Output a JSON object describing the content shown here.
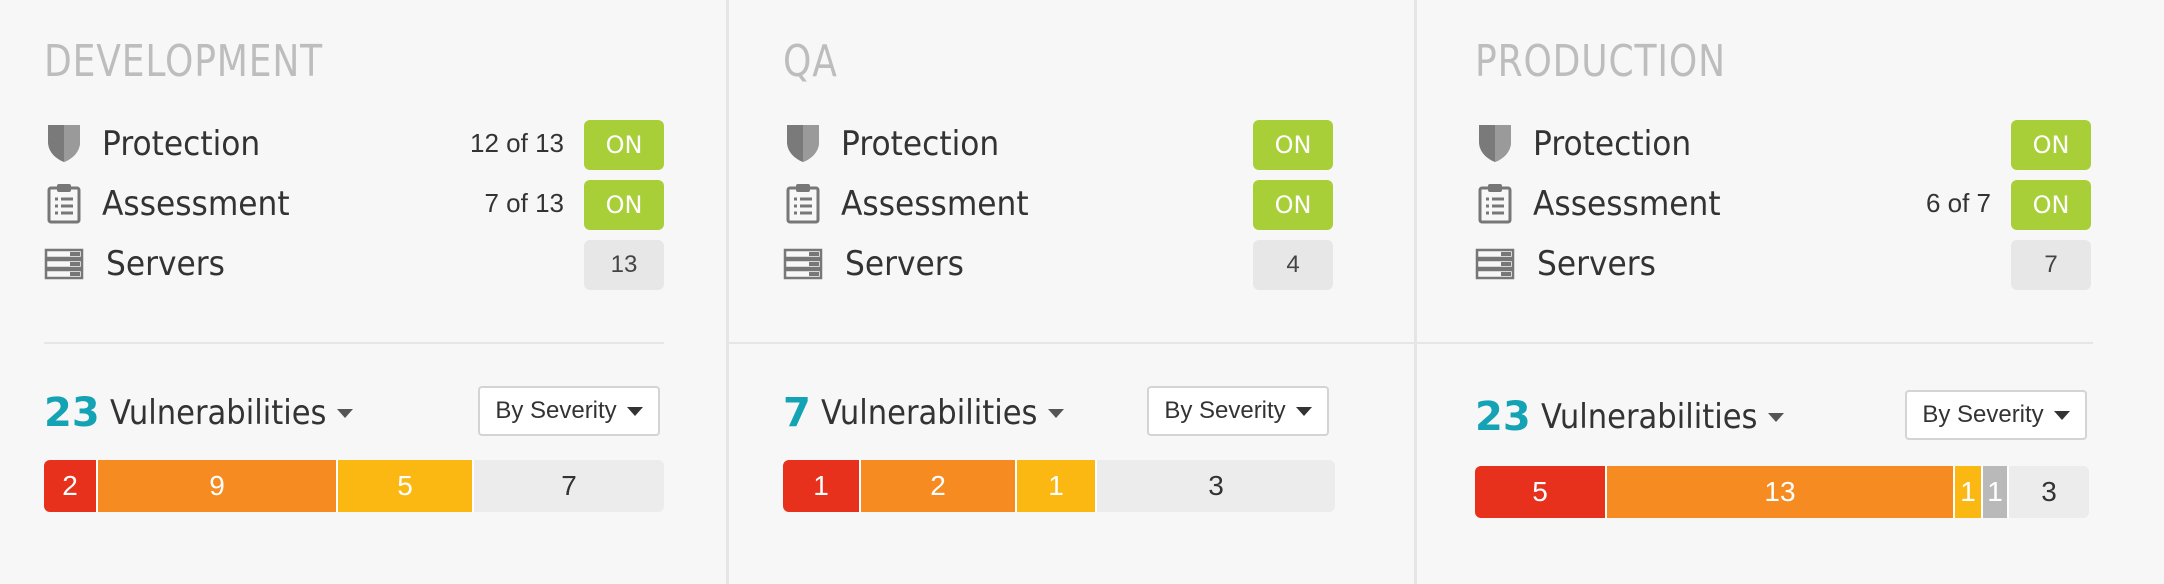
{
  "environments": [
    {
      "title": "DEVELOPMENT",
      "protection": {
        "label": "Protection",
        "count": "12 of 13",
        "status": "ON"
      },
      "assessment": {
        "label": "Assessment",
        "count": "7 of 13",
        "status": "ON"
      },
      "servers": {
        "label": "Servers",
        "count": "13"
      },
      "vulnerabilities": {
        "total": "23",
        "label": "Vulnerabilities",
        "filter": "By Severity"
      },
      "severity_bar": [
        {
          "level": "critical",
          "value": "2"
        },
        {
          "level": "high",
          "value": "9"
        },
        {
          "level": "medium",
          "value": "5"
        },
        {
          "level": "none",
          "value": "7"
        }
      ]
    },
    {
      "title": "QA",
      "protection": {
        "label": "Protection",
        "count": "",
        "status": "ON"
      },
      "assessment": {
        "label": "Assessment",
        "count": "",
        "status": "ON"
      },
      "servers": {
        "label": "Servers",
        "count": "4"
      },
      "vulnerabilities": {
        "total": "7",
        "label": "Vulnerabilities",
        "filter": "By Severity"
      },
      "severity_bar": [
        {
          "level": "critical",
          "value": "1"
        },
        {
          "level": "high",
          "value": "2"
        },
        {
          "level": "medium",
          "value": "1"
        },
        {
          "level": "none",
          "value": "3"
        }
      ]
    },
    {
      "title": "PRODUCTION",
      "protection": {
        "label": "Protection",
        "count": "",
        "status": "ON"
      },
      "assessment": {
        "label": "Assessment",
        "count": "6 of 7",
        "status": "ON"
      },
      "servers": {
        "label": "Servers",
        "count": "7"
      },
      "vulnerabilities": {
        "total": "23",
        "label": "Vulnerabilities",
        "filter": "By Severity"
      },
      "severity_bar": [
        {
          "level": "critical",
          "value": "5"
        },
        {
          "level": "high",
          "value": "13"
        },
        {
          "level": "medium",
          "value": "1"
        },
        {
          "level": "low",
          "value": "1"
        },
        {
          "level": "none",
          "value": "3"
        }
      ]
    }
  ],
  "colors": {
    "accent": "#13a3b4",
    "on_green": "#a8cf38",
    "critical": "#e8311d",
    "high": "#f68b21",
    "medium": "#fbb812",
    "low": "#b9b9b9"
  },
  "icons": {
    "protection": "shield-icon",
    "assessment": "clipboard-icon",
    "servers": "server-stack-icon"
  }
}
